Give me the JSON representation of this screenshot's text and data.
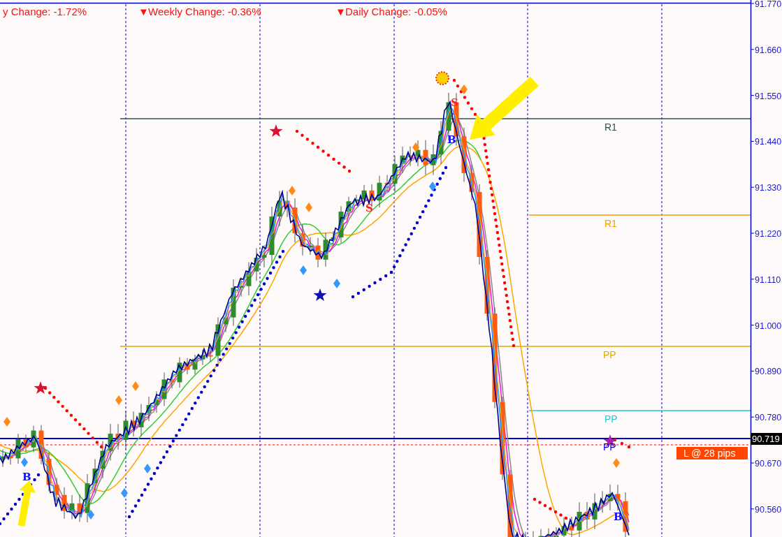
{
  "header_stats": [
    {
      "text": "y Change: -1.72%"
    },
    {
      "marker": "▼",
      "text": "Weekly Change: -0.36%"
    },
    {
      "marker": "▼",
      "text": "Daily Change: -0.05%"
    }
  ],
  "levels": [
    {
      "label": "R1",
      "color": "#2f4f4f"
    },
    {
      "label": "R1",
      "color": "#ff9900"
    },
    {
      "label": "PP",
      "color": "#e0a800"
    },
    {
      "label": "PP",
      "color": "#20c8d8"
    },
    {
      "label": "PP",
      "color": "#0000cc"
    }
  ],
  "signals": [
    {
      "text": "B",
      "kind": "buy"
    },
    {
      "text": "S",
      "kind": "sell"
    },
    {
      "text": "B",
      "kind": "buy"
    },
    {
      "text": "S",
      "kind": "sell"
    },
    {
      "text": "B",
      "kind": "buy"
    }
  ],
  "price_axis": {
    "ticks": [
      "91.770",
      "91.660",
      "91.550",
      "91.440",
      "91.330",
      "91.220",
      "91.110",
      "91.000",
      "90.890",
      "90.780",
      "90.670",
      "90.560"
    ],
    "current_price": "90.719"
  },
  "order_label": "L @ 28 pips"
}
